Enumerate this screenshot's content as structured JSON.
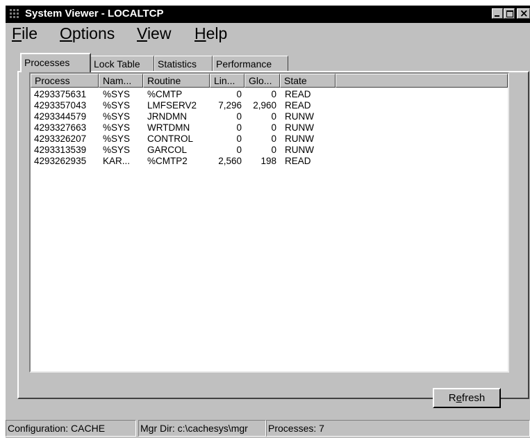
{
  "window": {
    "title": "System Viewer - LOCALTCP",
    "controls": [
      "minimize-icon",
      "maximize-icon",
      "close-icon"
    ],
    "close_glyph": "×"
  },
  "menu": [
    {
      "underline": "F",
      "rest": "ile"
    },
    {
      "underline": "O",
      "rest": "ptions"
    },
    {
      "underline": "V",
      "rest": "iew"
    },
    {
      "underline": "H",
      "rest": "elp"
    }
  ],
  "tabs": [
    "Processes",
    "Lock Table",
    "Statistics",
    "Performance"
  ],
  "active_tab": "Processes",
  "table": {
    "columns": [
      "Process",
      "Nam...",
      "Routine",
      "Lin...",
      "Glo...",
      "State"
    ],
    "rows": [
      [
        "4293375631",
        "%SYS",
        "%CMTP",
        "0",
        "0",
        "READ"
      ],
      [
        "4293357043",
        "%SYS",
        "LMFSERV2",
        "7,296",
        "2,960",
        "READ"
      ],
      [
        "4293344579",
        "%SYS",
        "JRNDMN",
        "0",
        "0",
        "RUNW"
      ],
      [
        "4293327663",
        "%SYS",
        "WRTDMN",
        "0",
        "0",
        "RUNW"
      ],
      [
        "4293326207",
        "%SYS",
        "CONTROL",
        "0",
        "0",
        "RUNW"
      ],
      [
        "4293313539",
        "%SYS",
        "GARCOL",
        "0",
        "0",
        "RUNW"
      ],
      [
        "4293262935",
        "KAR...",
        "%CMTP2",
        "2,560",
        "198",
        "READ"
      ]
    ]
  },
  "refresh": {
    "before": "R",
    "underline": "e",
    "after": "fresh"
  },
  "status": {
    "configuration": "Configuration: CACHE",
    "mgr_dir": "Mgr Dir: c:\\cachesys\\mgr",
    "processes": "Processes: 7"
  },
  "colors": {
    "face": "#c0c0c0",
    "titlebar": "#000000",
    "list_bg": "#ffffff"
  }
}
